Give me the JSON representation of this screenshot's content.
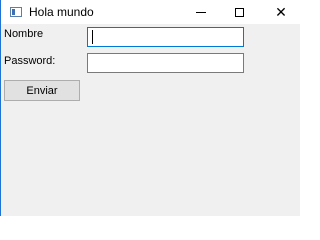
{
  "window": {
    "title": "Hola mundo",
    "controls": {
      "minimize_icon": "minimize-icon",
      "maximize_icon": "maximize-icon",
      "close_glyph": "✕"
    },
    "accent_color": "#0078d7",
    "background_color": "#f0f0f0"
  },
  "form": {
    "nombre_label": "Nombre",
    "nombre_value": "",
    "password_label": "Password:",
    "password_value": "",
    "submit_label": "Enviar"
  }
}
